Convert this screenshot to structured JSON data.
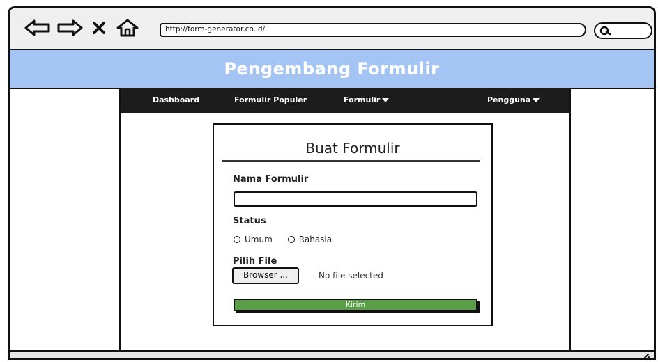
{
  "browser": {
    "url": "http://form-generator.co.id/"
  },
  "app": {
    "title": "Pengembang Formulir"
  },
  "topnav": {
    "dashboard": "Dashboard",
    "popular_forms": "Formulir Populer",
    "forms": "Formulir",
    "users": "Pengguna"
  },
  "form": {
    "title": "Buat Formulir",
    "name_label": "Nama Formulir",
    "name_value": "",
    "status_label": "Status",
    "status_options": [
      "Umum",
      "Rahasia"
    ],
    "file_label": "Pilih File",
    "browse_button": "Browser ...",
    "file_status": "No file selected",
    "submit_button": "Kirim"
  },
  "colors": {
    "header_bg": "#a4c5f4",
    "nav_bg": "#1c1c1c",
    "submit_bg": "#5b9e48"
  }
}
